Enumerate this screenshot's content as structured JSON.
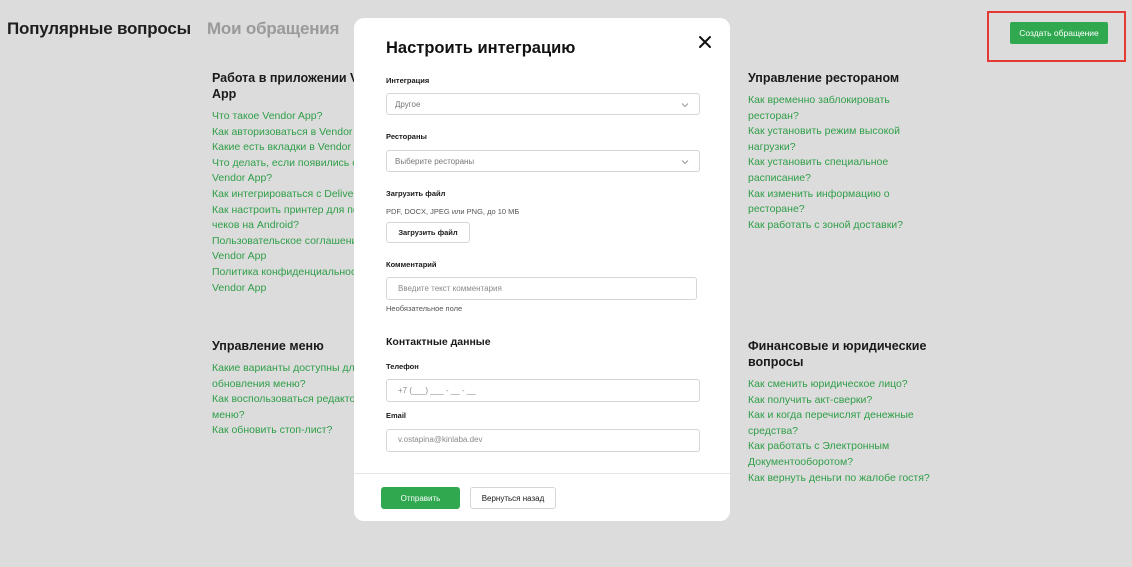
{
  "tabs": [
    "Популярные вопросы",
    "Мои обращения"
  ],
  "create_button": "Создать обращение",
  "sections": {
    "vendor": {
      "title": "Работа в приложении Vendor App",
      "links": [
        "Что такое Vendor App?",
        "Как авторизоваться в Vendor А",
        "Какие есть вкладки в Vendor А",
        "Что делать, если появились ош",
        "Vendor App?",
        "Как интегрироваться с Delivery",
        "Как настроить принтер для печ",
        "чеков на Android?",
        "Пользовательское соглашени",
        "Vendor App",
        "Политика конфиденциальност",
        "Vendor App"
      ]
    },
    "menu": {
      "title": "Управление меню",
      "links": [
        "Какие варианты доступны для",
        "обновления меню?",
        "Как воспользоваться редакто",
        "меню?",
        "Как обновить стоп-лист?"
      ]
    },
    "restaurant": {
      "title": "Управление рестораном",
      "links": [
        "Как временно заблокировать ресторан?",
        "Как установить режим высокой нагрузки?",
        "Как установить специальное расписание?",
        "Как изменить информацию о ресторане?",
        "Как работать с зоной доставки?"
      ]
    },
    "finance": {
      "title": "Финансовые и юридические вопросы",
      "links": [
        "Как сменить юридическое лицо?",
        "Как получить акт-сверки?",
        "Как и когда перечислят денежные средства?",
        "Как работать с Электронным Документооборотом?",
        "Как вернуть деньги по жалобе гостя?"
      ]
    }
  },
  "modal": {
    "title": "Настроить интеграцию",
    "integration_label": "Интеграция",
    "integration_value": "Другое",
    "restaurants_label": "Рестораны",
    "restaurants_placeholder": "Выберите рестораны",
    "upload_label": "Загрузить файл",
    "upload_hint": "PDF, DOCX, JPEG или PNG, до 10 МБ",
    "upload_button": "Загрузить файл",
    "comment_label": "Комментарий",
    "comment_placeholder": "Введите текст комментария",
    "comment_hint": "Необязательное поле",
    "contacts_heading": "Контактные данные",
    "phone_label": "Телефон",
    "phone_placeholder": "+7 (___) ___ - __ - __",
    "email_label": "Email",
    "email_value": "v.ostapina@kinlaba.dev",
    "submit_button": "Отправить",
    "back_button": "Вернуться назад"
  },
  "colors": {
    "accent": "#2fa84f",
    "highlight": "#e53935",
    "overlay": "#dcdcdc"
  },
  "icons": {
    "close": "close-icon",
    "dropdown": "chevron-down-icon"
  }
}
